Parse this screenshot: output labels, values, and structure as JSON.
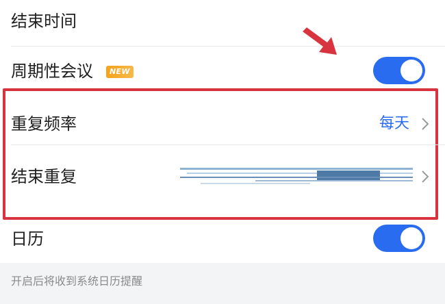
{
  "settings": {
    "end_time": {
      "label": "结束时间"
    },
    "recurring": {
      "label": "周期性会议",
      "badge": "NEW",
      "enabled": true
    },
    "frequency": {
      "label": "重复频率",
      "value": "每天"
    },
    "end_repeat": {
      "label": "结束重复"
    },
    "calendar": {
      "label": "日历",
      "enabled": true
    },
    "hint": "开启后将收到系统日历提醒"
  },
  "colors": {
    "accent": "#2a6cf0",
    "annotation": "#d8343f",
    "badge": "#f7a21a"
  },
  "icons": {
    "chevron": "chevron-right-icon",
    "arrow": "red-arrow-icon"
  }
}
